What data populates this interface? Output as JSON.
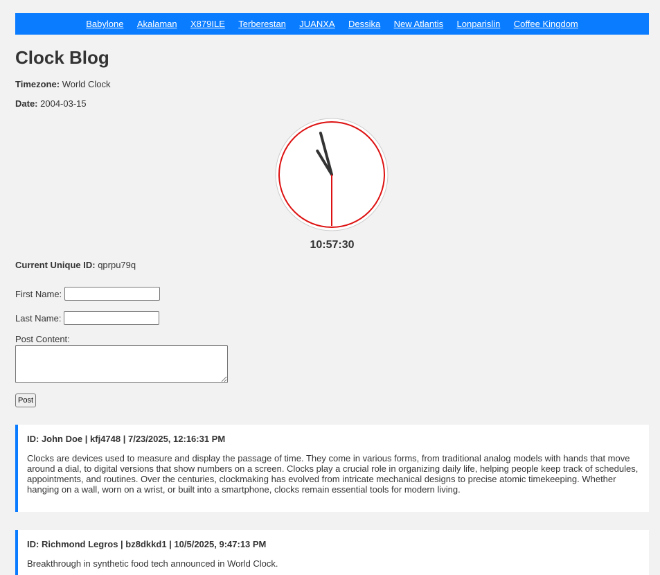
{
  "nav": {
    "links": [
      "Babylone",
      "Akalaman",
      "X879ILE",
      "Terberestan",
      "JUANXA",
      "Dessika",
      "New Atlantis",
      "Lonparislin",
      "Coffee Kingdom"
    ]
  },
  "page": {
    "title": "Clock Blog",
    "timezone_label": "Timezone:",
    "timezone_value": "World Clock",
    "date_label": "Date:",
    "date_value": "2004-03-15"
  },
  "clock": {
    "time": "10:57:30",
    "hours": 10,
    "minutes": 57,
    "seconds": 30,
    "face_color": "#ffffff",
    "border_color": "#dd1111",
    "hand_color": "#333333",
    "second_hand_color": "#dd1111"
  },
  "unique_id": {
    "label": "Current Unique ID:",
    "value": "qprpu79q"
  },
  "form": {
    "first_name_label": "First Name:",
    "first_name_value": "",
    "last_name_label": "Last Name:",
    "last_name_value": "",
    "content_label": "Post Content:",
    "content_value": "",
    "post_button": "Post"
  },
  "posts": [
    {
      "header": "ID: John Doe | kfj4748 | 7/23/2025, 12:16:31 PM",
      "body": "Clocks are devices used to measure and display the passage of time. They come in various forms, from traditional analog models with hands that move around a dial, to digital versions that show numbers on a screen. Clocks play a crucial role in organizing daily life, helping people keep track of schedules, appointments, and routines. Over the centuries, clockmaking has evolved from intricate mechanical designs to precise atomic timekeeping. Whether hanging on a wall, worn on a wrist, or built into a smartphone, clocks remain essential tools for modern living."
    },
    {
      "header": "ID: Richmond Legros | bz8dkkd1 | 10/5/2025, 9:47:13 PM",
      "body": "Breakthrough in synthetic food tech announced in World Clock."
    }
  ],
  "colors": {
    "accent": "#0a7cff",
    "background": "#f2f2f2"
  }
}
